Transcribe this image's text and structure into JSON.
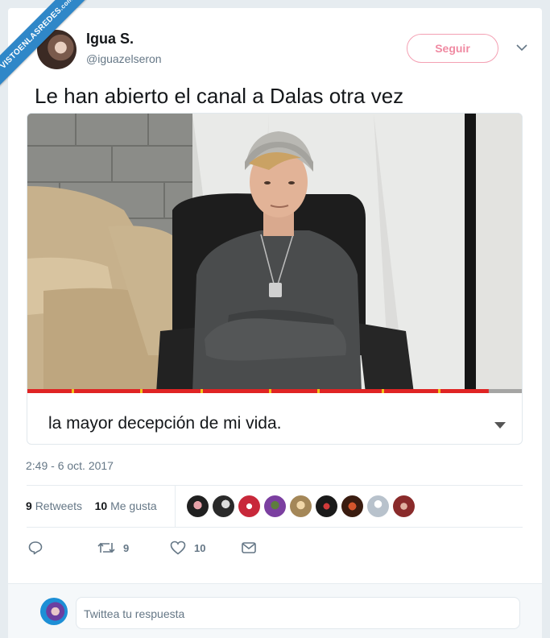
{
  "watermark": {
    "text": "VISTOENLASREDES",
    "suffix": ".com"
  },
  "tweet": {
    "author_name": "Igua S.",
    "author_handle": "@iguazelseron",
    "follow_label": "Seguir",
    "text": "Le han abierto el canal a Dalas otra vez",
    "media_caption": "la mayor decepción de mi vida.",
    "video_progress": 0.93,
    "timestamp": "2:49 - 6 oct. 2017"
  },
  "stats": {
    "retweets_count": "9",
    "retweets_label": "Retweets",
    "likes_count": "10",
    "likes_label": "Me gusta",
    "liker_avatars": [
      "liker-1",
      "liker-2",
      "liker-3",
      "liker-4",
      "liker-5",
      "liker-6",
      "liker-7",
      "liker-8",
      "liker-9"
    ]
  },
  "actions": {
    "reply_icon": "reply-icon",
    "retweet_icon": "retweet-icon",
    "retweet_count": "9",
    "like_icon": "heart-icon",
    "like_count": "10",
    "dm_icon": "envelope-icon"
  },
  "reply_box": {
    "placeholder": "Twittea tu respuesta"
  },
  "colors": {
    "follow_accent": "#f08aa2",
    "progress_red": "#e02424",
    "watermark_blue": "#2f87c8",
    "muted_text": "#657786"
  }
}
